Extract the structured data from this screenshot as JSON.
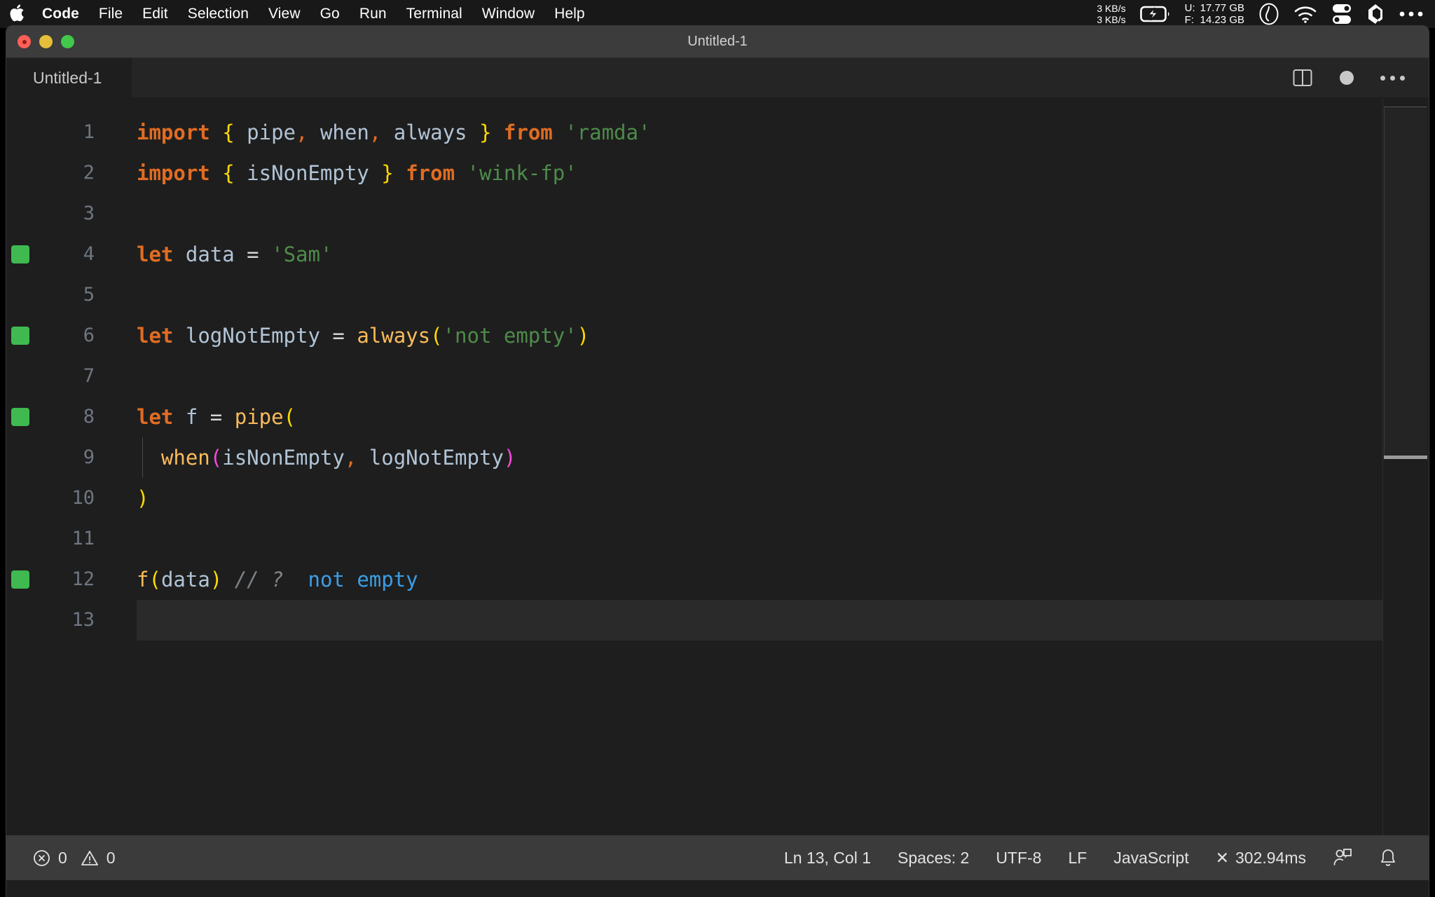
{
  "menubar": {
    "apple_icon": "apple-logo-icon",
    "items": [
      {
        "label": "Code",
        "bold": true
      },
      {
        "label": "File",
        "bold": false
      },
      {
        "label": "Edit",
        "bold": false
      },
      {
        "label": "Selection",
        "bold": false
      },
      {
        "label": "View",
        "bold": false
      },
      {
        "label": "Go",
        "bold": false
      },
      {
        "label": "Run",
        "bold": false
      },
      {
        "label": "Terminal",
        "bold": false
      },
      {
        "label": "Window",
        "bold": false
      },
      {
        "label": "Help",
        "bold": false
      }
    ],
    "network": {
      "upload": "3 KB/s",
      "download": "3 KB/s"
    },
    "battery_icon": "battery-charging-icon",
    "memory": {
      "used_label": "U:",
      "used_value": "17.77 GB",
      "free_label": "F:",
      "free_value": "14.23 GB"
    },
    "status_icons": [
      "clock-icon",
      "wifi-icon",
      "control-center-icon",
      "dropbox-icon",
      "more-icon"
    ]
  },
  "window": {
    "title": "Untitled-1",
    "traffic_lights": [
      "close-button",
      "minimize-button",
      "zoom-button"
    ]
  },
  "tabbar": {
    "tabs": [
      {
        "label": "Untitled-1",
        "active": true,
        "dirty": true
      }
    ],
    "actions": [
      "split-editor-icon",
      "unsaved-dot-icon",
      "more-actions-icon"
    ]
  },
  "editor": {
    "language": "JavaScript",
    "lines": [
      {
        "num": "1",
        "marker": false,
        "indent_guide": false,
        "current": false,
        "tokens": [
          {
            "t": "import",
            "c": "t-kw"
          },
          {
            "t": " ",
            "c": "t-op"
          },
          {
            "t": "{",
            "c": "t-br1"
          },
          {
            "t": " ",
            "c": "t-op"
          },
          {
            "t": "pipe",
            "c": "t-var"
          },
          {
            "t": ",",
            "c": "t-comma"
          },
          {
            "t": " ",
            "c": "t-op"
          },
          {
            "t": "when",
            "c": "t-var"
          },
          {
            "t": ",",
            "c": "t-comma"
          },
          {
            "t": " ",
            "c": "t-op"
          },
          {
            "t": "always",
            "c": "t-var"
          },
          {
            "t": " ",
            "c": "t-op"
          },
          {
            "t": "}",
            "c": "t-br1"
          },
          {
            "t": " ",
            "c": "t-op"
          },
          {
            "t": "from",
            "c": "t-kw"
          },
          {
            "t": " ",
            "c": "t-op"
          },
          {
            "t": "'ramda'",
            "c": "t-str"
          }
        ]
      },
      {
        "num": "2",
        "marker": false,
        "indent_guide": false,
        "current": false,
        "tokens": [
          {
            "t": "import",
            "c": "t-kw"
          },
          {
            "t": " ",
            "c": "t-op"
          },
          {
            "t": "{",
            "c": "t-br1"
          },
          {
            "t": " ",
            "c": "t-op"
          },
          {
            "t": "isNonEmpty",
            "c": "t-var"
          },
          {
            "t": " ",
            "c": "t-op"
          },
          {
            "t": "}",
            "c": "t-br1"
          },
          {
            "t": " ",
            "c": "t-op"
          },
          {
            "t": "from",
            "c": "t-kw"
          },
          {
            "t": " ",
            "c": "t-op"
          },
          {
            "t": "'wink-fp'",
            "c": "t-str"
          }
        ]
      },
      {
        "num": "3",
        "marker": false,
        "indent_guide": false,
        "current": false,
        "tokens": []
      },
      {
        "num": "4",
        "marker": true,
        "indent_guide": false,
        "current": false,
        "tokens": [
          {
            "t": "let",
            "c": "t-kw"
          },
          {
            "t": " ",
            "c": "t-op"
          },
          {
            "t": "data",
            "c": "t-var"
          },
          {
            "t": " ",
            "c": "t-op"
          },
          {
            "t": "=",
            "c": "t-op"
          },
          {
            "t": " ",
            "c": "t-op"
          },
          {
            "t": "'Sam'",
            "c": "t-str"
          }
        ]
      },
      {
        "num": "5",
        "marker": false,
        "indent_guide": false,
        "current": false,
        "tokens": []
      },
      {
        "num": "6",
        "marker": true,
        "indent_guide": false,
        "current": false,
        "tokens": [
          {
            "t": "let",
            "c": "t-kw"
          },
          {
            "t": " ",
            "c": "t-op"
          },
          {
            "t": "logNotEmpty",
            "c": "t-var"
          },
          {
            "t": " ",
            "c": "t-op"
          },
          {
            "t": "=",
            "c": "t-op"
          },
          {
            "t": " ",
            "c": "t-op"
          },
          {
            "t": "always",
            "c": "t-fn"
          },
          {
            "t": "(",
            "c": "t-br1"
          },
          {
            "t": "'not empty'",
            "c": "t-str"
          },
          {
            "t": ")",
            "c": "t-br1"
          }
        ]
      },
      {
        "num": "7",
        "marker": false,
        "indent_guide": false,
        "current": false,
        "tokens": []
      },
      {
        "num": "8",
        "marker": true,
        "indent_guide": false,
        "current": false,
        "tokens": [
          {
            "t": "let",
            "c": "t-kw"
          },
          {
            "t": " ",
            "c": "t-op"
          },
          {
            "t": "f",
            "c": "t-var"
          },
          {
            "t": " ",
            "c": "t-op"
          },
          {
            "t": "=",
            "c": "t-op"
          },
          {
            "t": " ",
            "c": "t-op"
          },
          {
            "t": "pipe",
            "c": "t-fn"
          },
          {
            "t": "(",
            "c": "t-br1"
          }
        ]
      },
      {
        "num": "9",
        "marker": false,
        "indent_guide": true,
        "current": false,
        "tokens": [
          {
            "t": "  ",
            "c": "t-op"
          },
          {
            "t": "when",
            "c": "t-fn"
          },
          {
            "t": "(",
            "c": "t-br2"
          },
          {
            "t": "isNonEmpty",
            "c": "t-var"
          },
          {
            "t": ",",
            "c": "t-comma"
          },
          {
            "t": " ",
            "c": "t-op"
          },
          {
            "t": "logNotEmpty",
            "c": "t-var"
          },
          {
            "t": ")",
            "c": "t-br2"
          }
        ]
      },
      {
        "num": "10",
        "marker": false,
        "indent_guide": false,
        "current": false,
        "tokens": [
          {
            "t": ")",
            "c": "t-br1"
          }
        ]
      },
      {
        "num": "11",
        "marker": false,
        "indent_guide": false,
        "current": false,
        "tokens": []
      },
      {
        "num": "12",
        "marker": true,
        "indent_guide": false,
        "current": false,
        "tokens": [
          {
            "t": "f",
            "c": "t-fn"
          },
          {
            "t": "(",
            "c": "t-br1"
          },
          {
            "t": "data",
            "c": "t-var"
          },
          {
            "t": ")",
            "c": "t-br1"
          },
          {
            "t": " ",
            "c": "t-op"
          },
          {
            "t": "// ?",
            "c": "t-comment"
          },
          {
            "t": "  ",
            "c": "t-op"
          },
          {
            "t": "not empty",
            "c": "t-quokka"
          }
        ]
      },
      {
        "num": "13",
        "marker": false,
        "indent_guide": false,
        "current": true,
        "tokens": []
      }
    ]
  },
  "statusbar": {
    "error_icon": "error-circle-icon",
    "error_count": "0",
    "warning_icon": "warning-triangle-icon",
    "warning_count": "0",
    "cursor_position": "Ln 13, Col 1",
    "indentation": "Spaces: 2",
    "encoding": "UTF-8",
    "eol": "LF",
    "language": "JavaScript",
    "quokka_status": "302.94ms",
    "quokka_prefix": "✕",
    "remote_icon": "remote-account-icon",
    "bell_icon": "notifications-bell-icon"
  },
  "colors": {
    "editor_bg": "#1e1e1e",
    "titlebar_bg": "#3c3c3c",
    "statusbar_bg": "#3b3b3b",
    "keyword": "#e06c23",
    "string": "#4e8b4a",
    "variable": "#b1c4d6",
    "function": "#fcbb5b",
    "bracket_level1": "#ffd900",
    "bracket_level2": "#f24ad9",
    "comment": "#7f8387",
    "quokka_value": "#3b9ee5",
    "marker_green": "#3fb950"
  }
}
